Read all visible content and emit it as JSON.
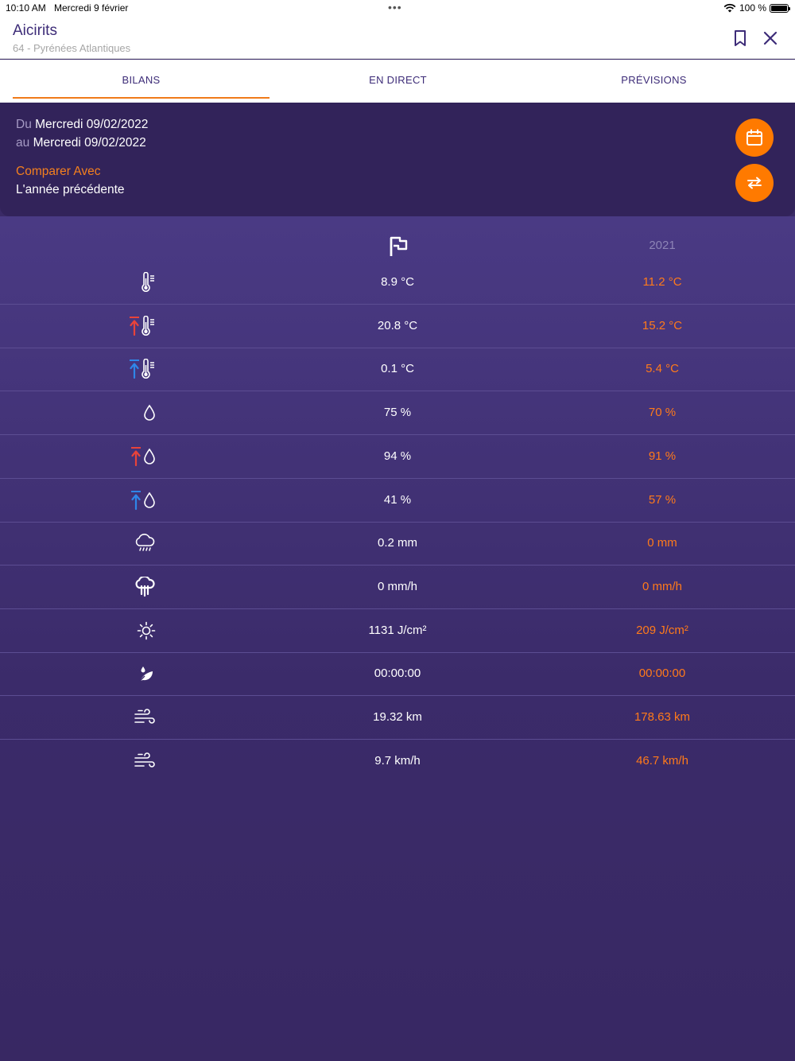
{
  "status_bar": {
    "time": "10:10 AM",
    "date": "Mercredi 9 février",
    "battery_level": "100 %"
  },
  "header": {
    "station_name": "Aicirits",
    "region": "64 - Pyrénées Atlantiques"
  },
  "tabs": [
    {
      "label": "BILANS",
      "active": true
    },
    {
      "label": "EN DIRECT",
      "active": false
    },
    {
      "label": "PRÉVISIONS",
      "active": false
    }
  ],
  "period": {
    "from_prefix": "Du",
    "from_date": "Mercredi 09/02/2022",
    "to_prefix": "au",
    "to_date": "Mercredi 09/02/2022",
    "compare_label": "Comparer Avec",
    "compare_value": "L'année précédente"
  },
  "table": {
    "previous_year": "2021",
    "rows": [
      {
        "icon": "thermometer-icon",
        "current": "8.9 °C",
        "previous": "11.2 °C"
      },
      {
        "icon": "max-temperature-icon",
        "current": "20.8 °C",
        "previous": "15.2 °C"
      },
      {
        "icon": "min-temperature-icon",
        "current": "0.1 °C",
        "previous": "5.4 °C"
      },
      {
        "icon": "humidity-drop-icon",
        "current": "75 %",
        "previous": "70 %"
      },
      {
        "icon": "max-humidity-icon",
        "current": "94 %",
        "previous": "91 %"
      },
      {
        "icon": "min-humidity-icon",
        "current": "41 %",
        "previous": "57 %"
      },
      {
        "icon": "rain-cloud-icon",
        "current": "0.2 mm",
        "previous": "0 mm"
      },
      {
        "icon": "rain-intensity-icon",
        "current": "0 mm/h",
        "previous": "0 mm/h"
      },
      {
        "icon": "sun-icon",
        "current": "1131 J/cm²",
        "previous": "209 J/cm²"
      },
      {
        "icon": "leaf-wetness-icon",
        "current": "00:00:00",
        "previous": "00:00:00"
      },
      {
        "icon": "wind-icon",
        "current": "19.32 km",
        "previous": "178.63 km"
      },
      {
        "icon": "wind-speed-icon",
        "current": "9.7 km/h",
        "previous": "46.7 km/h"
      }
    ]
  },
  "colors": {
    "brand_purple": "#3d2c78",
    "accent_orange": "#ff7a00",
    "max_red": "#e8433a",
    "min_blue": "#2f86e8"
  }
}
